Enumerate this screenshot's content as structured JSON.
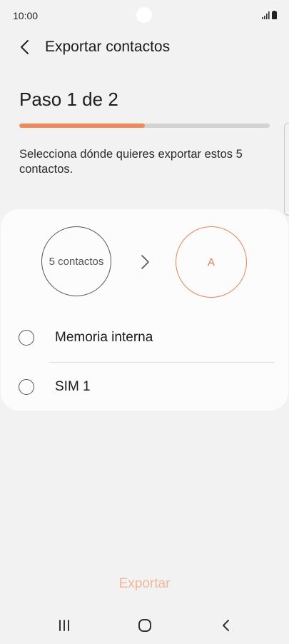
{
  "status_bar": {
    "time": "10:00",
    "icons": [
      "signal-icon",
      "battery-icon"
    ]
  },
  "app_bar": {
    "back_icon": "chevron-left-icon",
    "title": "Exportar contactos"
  },
  "step": {
    "title": "Paso 1 de 2",
    "progress": 0.5
  },
  "description": "Selecciona dónde quieres exportar estos 5 contactos.",
  "transfer": {
    "source_label": "5 contactos",
    "arrow_icon": "chevron-right-icon",
    "target_label": "A"
  },
  "options": [
    {
      "label": "Memoria interna",
      "selected": false
    },
    {
      "label": "SIM 1",
      "selected": false
    }
  ],
  "export_button": {
    "label": "Exportar",
    "enabled": false
  },
  "nav_bar": {
    "icons": [
      "recent-apps-icon",
      "home-icon",
      "back-icon"
    ]
  },
  "colors": {
    "accent": "#ef8a5b",
    "background": "#f2f2f2",
    "card": "#fcfcfc"
  }
}
